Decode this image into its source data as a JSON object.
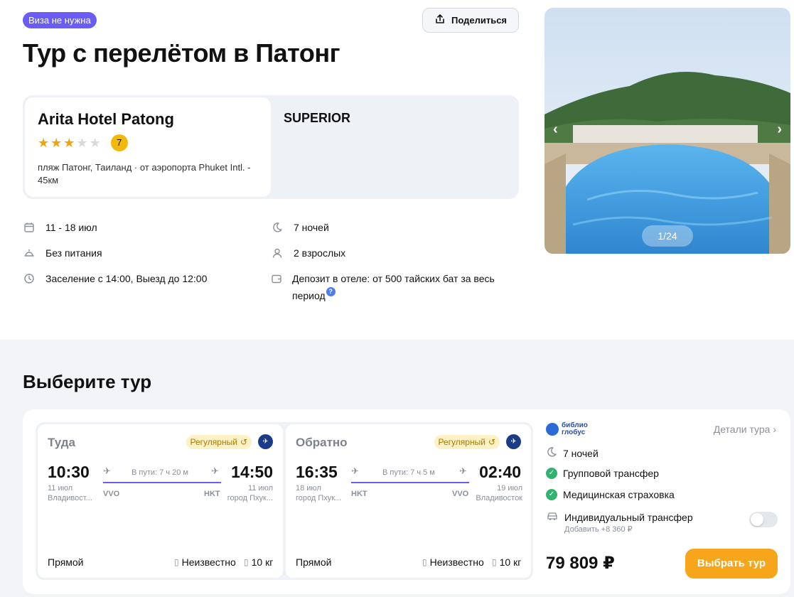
{
  "header": {
    "visa_badge": "Виза не нужна",
    "share_label": "Поделиться",
    "title": "Тур с перелётом в Патонг"
  },
  "hotel": {
    "name": "Arita Hotel Patong",
    "stars": 3,
    "stars_max": 5,
    "rating": "7",
    "location": "пляж Патонг, Таиланд · от аэропорта Phuket Intl. - 45км",
    "category": "SUPERIOR"
  },
  "details": {
    "dates": "11 - 18 июл",
    "nights": "7 ночей",
    "meals": "Без питания",
    "guests": "2 взрослых",
    "checkin": "Заселение с 14:00, Выезд до 12:00",
    "deposit": "Депозит в отеле: от 500 тайских бат за весь период",
    "deposit_help": "?"
  },
  "gallery": {
    "counter": "1/24",
    "prev": "‹",
    "next": "›"
  },
  "tours": {
    "section_title": "Выберите тур",
    "outbound": {
      "direction": "Туда",
      "badge": "Регулярный",
      "dep_time": "10:30",
      "arr_time": "14:50",
      "duration": "В пути: 7 ч 20 м",
      "dep_date": "11 июл",
      "dep_city": "Владивост...",
      "arr_date": "11 июл",
      "arr_city": "город Пхук...",
      "dep_code": "VVO",
      "arr_code": "HKT",
      "stops": "Прямой",
      "hand_luggage": "Неизвестно",
      "baggage": "10 кг"
    },
    "inbound": {
      "direction": "Обратно",
      "badge": "Регулярный",
      "dep_time": "16:35",
      "arr_time": "02:40",
      "duration": "В пути: 7 ч 5 м",
      "dep_date": "18 июл",
      "dep_city": "город Пхук...",
      "arr_date": "19 июл",
      "arr_city": "Владивосток",
      "dep_code": "HKT",
      "arr_code": "VVO",
      "stops": "Прямой",
      "hand_luggage": "Неизвестно",
      "baggage": "10 кг"
    },
    "operator": {
      "logo_line1": "библио",
      "logo_line2": "глобус",
      "details_link": "Детали тура",
      "nights": "7 ночей",
      "transfer": "Групповой трансфер",
      "insurance": "Медицинская страховка",
      "individual_transfer": "Индивидуальный трансфер",
      "individual_transfer_price": "Добавить +8 360 ₽",
      "price": "79 809 ₽",
      "select_label": "Выбрать тур"
    }
  },
  "colors": {
    "accent": "#6b5cf6",
    "cta": "#f7a51b",
    "star": "#f2a20c",
    "check": "#2fb36f"
  }
}
